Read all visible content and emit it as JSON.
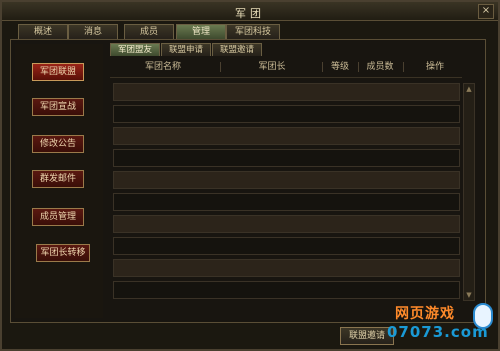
{
  "window": {
    "title": "军团",
    "close_label": "×"
  },
  "main_tabs": [
    {
      "label": "概述"
    },
    {
      "label": "消息"
    },
    {
      "label": "成员"
    },
    {
      "label": "管理"
    },
    {
      "label": "军团科技"
    }
  ],
  "active_main_tab": "管理",
  "sidebar": {
    "buttons": [
      {
        "label": "军团联盟"
      },
      {
        "label": "军团宣战"
      },
      {
        "label": "修改公告"
      },
      {
        "label": "群发邮件"
      },
      {
        "label": "成员管理"
      },
      {
        "label": "军团长转移"
      }
    ]
  },
  "sub_tabs": [
    {
      "label": "军团盟友"
    },
    {
      "label": "联盟申请"
    },
    {
      "label": "联盟邀请"
    }
  ],
  "table": {
    "columns": [
      "军团名称",
      "军团长",
      "等级",
      "成员数",
      "操作"
    ]
  },
  "footer": {
    "invite_button": "联盟邀请"
  },
  "watermark": {
    "top": "网页游戏",
    "bottom": "07073.com"
  }
}
